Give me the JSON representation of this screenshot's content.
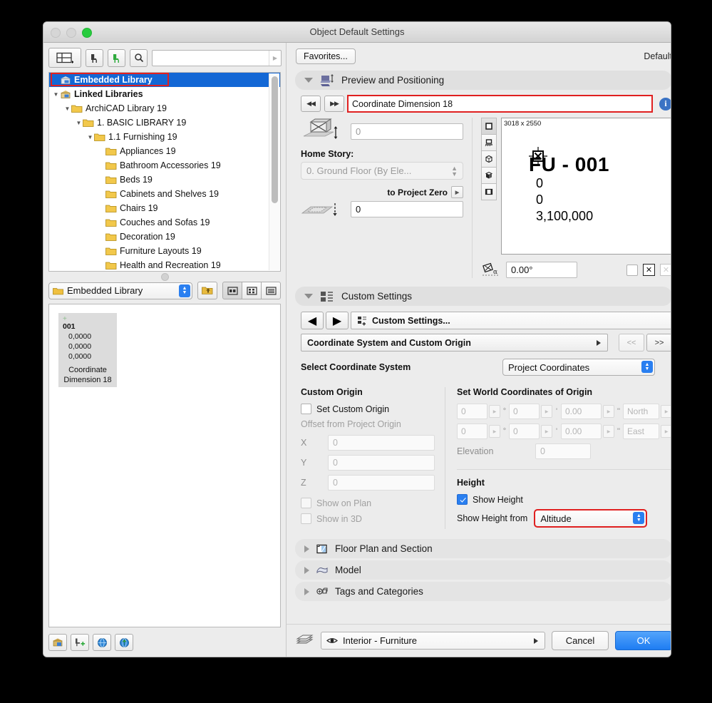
{
  "window": {
    "title": "Object Default Settings"
  },
  "library_panel": {
    "search_placeholder": "",
    "search_value": "",
    "tree": [
      {
        "label": "Embedded Library",
        "indent": 0,
        "twisty": "none",
        "icon": "embedded-library-icon",
        "bold": true,
        "selected": true
      },
      {
        "label": "Linked Libraries",
        "indent": 0,
        "twisty": "down",
        "icon": "linked-library-icon",
        "bold": true,
        "selected": false
      },
      {
        "label": "ArchiCAD Library 19",
        "indent": 1,
        "twisty": "down",
        "icon": "folder-icon",
        "bold": false,
        "selected": false
      },
      {
        "label": "1. BASIC LIBRARY 19",
        "indent": 2,
        "twisty": "down",
        "icon": "folder-icon",
        "bold": false,
        "selected": false
      },
      {
        "label": "1.1 Furnishing 19",
        "indent": 3,
        "twisty": "down",
        "icon": "folder-icon",
        "bold": false,
        "selected": false
      },
      {
        "label": "Appliances 19",
        "indent": 4,
        "twisty": "none",
        "icon": "folder-icon",
        "bold": false,
        "selected": false
      },
      {
        "label": "Bathroom Accessories 19",
        "indent": 4,
        "twisty": "none",
        "icon": "folder-icon",
        "bold": false,
        "selected": false
      },
      {
        "label": "Beds 19",
        "indent": 4,
        "twisty": "none",
        "icon": "folder-icon",
        "bold": false,
        "selected": false
      },
      {
        "label": "Cabinets and Shelves 19",
        "indent": 4,
        "twisty": "none",
        "icon": "folder-icon",
        "bold": false,
        "selected": false
      },
      {
        "label": "Chairs 19",
        "indent": 4,
        "twisty": "none",
        "icon": "folder-icon",
        "bold": false,
        "selected": false
      },
      {
        "label": "Couches and Sofas 19",
        "indent": 4,
        "twisty": "none",
        "icon": "folder-icon",
        "bold": false,
        "selected": false
      },
      {
        "label": "Decoration 19",
        "indent": 4,
        "twisty": "none",
        "icon": "folder-icon",
        "bold": false,
        "selected": false
      },
      {
        "label": "Furniture Layouts 19",
        "indent": 4,
        "twisty": "none",
        "icon": "folder-icon",
        "bold": false,
        "selected": false
      },
      {
        "label": "Health and Recreation 19",
        "indent": 4,
        "twisty": "none",
        "icon": "folder-icon",
        "bold": false,
        "selected": false
      }
    ],
    "folder_selector": "Embedded Library",
    "thumbnail": {
      "number": "001",
      "lines": [
        "0,0000",
        "0,0000",
        "0,0000"
      ],
      "caption_line1": "Coordinate",
      "caption_line2": "Dimension 18"
    }
  },
  "right_panel": {
    "favorites_label": "Favorites...",
    "default_label": "Default",
    "preview_section": {
      "title": "Preview and Positioning",
      "object_name": "Coordinate Dimension 18",
      "elevation_value": "0",
      "home_story_label": "Home Story:",
      "home_story_value": "0. Ground Floor (By Ele...",
      "to_project_zero_label": "to Project Zero",
      "project_zero_value": "0",
      "preview_dimensions": "3018 x 2550",
      "preview_title": "FU - 001",
      "preview_lines": [
        "0",
        "0",
        "3,100,000"
      ],
      "angle_value": "0.00°"
    },
    "custom_section": {
      "title": "Custom Settings",
      "custom_settings_label": "Custom Settings...",
      "page_label": "Coordinate System and Custom Origin",
      "prev_label": "<<",
      "next_label": ">>",
      "select_coordinate_system_label": "Select Coordinate System",
      "coordinate_system_value": "Project Coordinates",
      "custom_origin": {
        "group_title": "Custom Origin",
        "set_custom_origin_label": "Set Custom Origin",
        "set_custom_origin_checked": false,
        "offset_label": "Offset from Project Origin",
        "fields": [
          {
            "label": "X",
            "value": "0"
          },
          {
            "label": "Y",
            "value": "0"
          },
          {
            "label": "Z",
            "value": "0"
          }
        ],
        "show_on_plan_label": "Show on Plan",
        "show_on_plan_checked": false,
        "show_in_3d_label": "Show in 3D",
        "show_in_3d_checked": false
      },
      "world_coordinates": {
        "group_title": "Set World Coordinates of Origin",
        "rows": [
          {
            "deg": "0",
            "min": "0",
            "sec": "0.00",
            "dir": "North"
          },
          {
            "deg": "0",
            "min": "0",
            "sec": "0.00",
            "dir": "East"
          }
        ],
        "deg_unit": "°",
        "min_unit": "'",
        "sec_unit": "''",
        "elevation_label": "Elevation",
        "elevation_value": "0"
      },
      "height": {
        "group_title": "Height",
        "show_height_label": "Show Height",
        "show_height_checked": true,
        "show_height_from_label": "Show Height from",
        "show_height_from_value": "Altitude"
      }
    },
    "collapsed_sections": [
      {
        "label": "Floor Plan and Section",
        "icon": "floor-plan-icon"
      },
      {
        "label": "Model",
        "icon": "model-icon"
      },
      {
        "label": "Tags and Categories",
        "icon": "tags-icon"
      }
    ],
    "footer": {
      "layer_value": "Interior - Furniture",
      "cancel_label": "Cancel",
      "ok_label": "OK"
    }
  },
  "colors": {
    "selection_blue": "#1367d5",
    "accent_blue": "#2a7ff0",
    "highlight_red": "#e02020",
    "window_chrome": "#ececec"
  }
}
